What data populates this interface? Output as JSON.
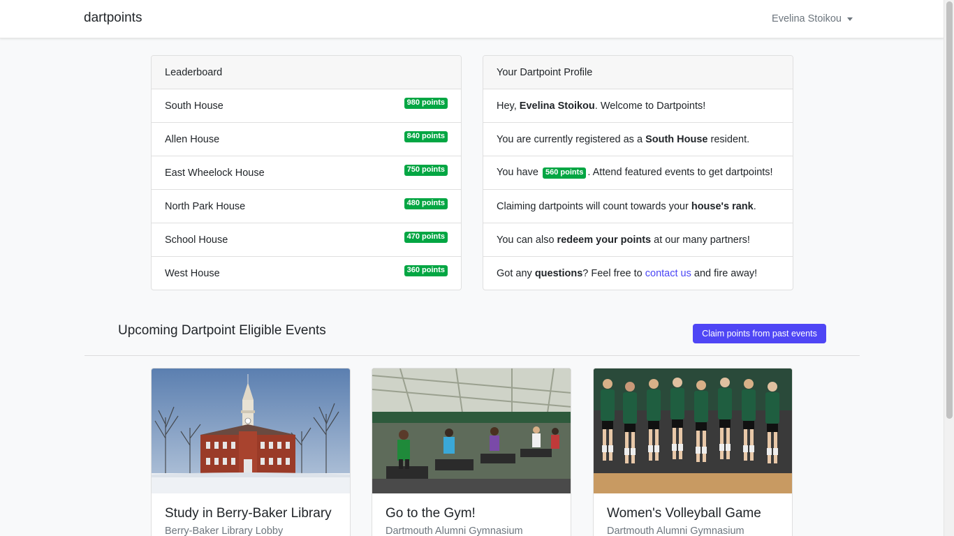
{
  "nav": {
    "brand": "dartpoints",
    "user_name": "Evelina Stoikou"
  },
  "leaderboard": {
    "title": "Leaderboard",
    "items": [
      {
        "name": "South House",
        "points": "980 points"
      },
      {
        "name": "Allen House",
        "points": "840 points"
      },
      {
        "name": "East Wheelock House",
        "points": "750 points"
      },
      {
        "name": "North Park House",
        "points": "480 points"
      },
      {
        "name": "School House",
        "points": "470 points"
      },
      {
        "name": "West House",
        "points": "360 points"
      }
    ]
  },
  "profile": {
    "title": "Your Dartpoint Profile",
    "greeting_pre": "Hey, ",
    "user_name": "Evelina Stoikou",
    "greeting_post": ". Welcome to Dartpoints!",
    "registered_pre": "You are currently registered as a ",
    "house": "South House",
    "registered_post": " resident.",
    "points_pre": "You have ",
    "points_badge": "560 points",
    "points_post": ". Attend featured events to get dartpoints!",
    "rank_pre": "Claiming dartpoints will count towards your ",
    "rank_bold": "house's rank",
    "rank_post": ".",
    "redeem_pre": "You can also ",
    "redeem_bold": "redeem your points",
    "redeem_post": " at our many partners!",
    "questions_pre": "Got any ",
    "questions_bold": "questions",
    "questions_mid": "? Feel free to ",
    "contact_link": "contact us",
    "questions_post": " and fire away!"
  },
  "events": {
    "section_title": "Upcoming Dartpoint Eligible Events",
    "claim_button": "Claim points from past events",
    "items": [
      {
        "title": "Study in Berry-Baker Library",
        "location": "Berry-Baker Library Lobby"
      },
      {
        "title": "Go to the Gym!",
        "location": "Dartmouth Alumni Gymnasium"
      },
      {
        "title": "Women's Volleyball Game",
        "location": "Dartmouth Alumni Gymnasium"
      }
    ]
  },
  "colors": {
    "badge_green": "#03a643",
    "primary_button": "#4f46f5",
    "link": "#4a46f5"
  }
}
